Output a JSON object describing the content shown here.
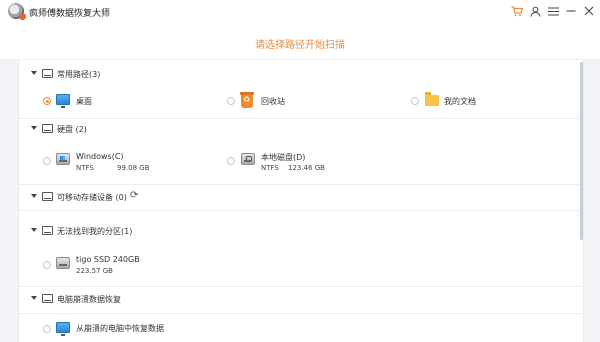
{
  "app": {
    "title": "疯师傅数据恢复大师"
  },
  "titlebar_icons": [
    "cart-icon",
    "user-icon",
    "menu-icon",
    "minimize-icon",
    "close-icon"
  ],
  "prompt": "请选择路径开始扫描",
  "sections": {
    "common": {
      "label": "常用路径(3)",
      "items": [
        {
          "label": "桌面",
          "selected": true
        },
        {
          "label": "回收站",
          "selected": false
        },
        {
          "label": "我的文档",
          "selected": false
        }
      ]
    },
    "hard_disk": {
      "label": "硬盘 (2)",
      "drives": [
        {
          "name": "Windows(C)",
          "fs": "NTFS",
          "size": "99.08 GB"
        },
        {
          "name": "本地磁盘(D)",
          "fs": "NTFS",
          "size": "123.46 GB"
        }
      ]
    },
    "removable": {
      "label": "可移动存储设备 (0)"
    },
    "lost_partition": {
      "label": "无法找到我的分区(1)",
      "drives": [
        {
          "name": "tigo SSD 240GB",
          "size": "223.57 GB"
        }
      ]
    },
    "crash": {
      "label": "电脑崩溃数据恢复",
      "items": [
        {
          "label": "从崩溃的电脑中恢复数据"
        }
      ]
    }
  },
  "colors": {
    "accent": "#f08a3c",
    "background": "#f2f4f7"
  }
}
